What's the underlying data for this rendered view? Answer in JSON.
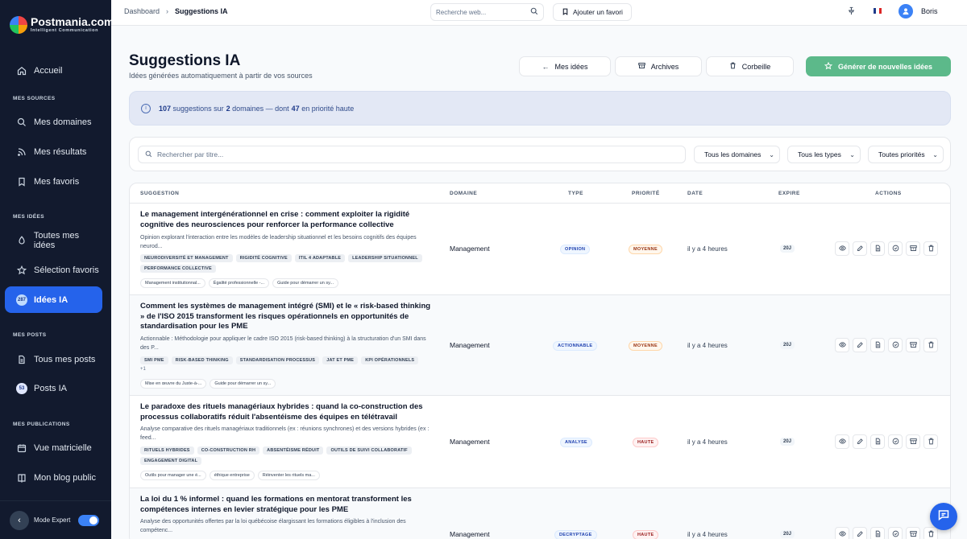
{
  "brand": {
    "name": "Postmania.com",
    "tagline": "Intelligent Communication"
  },
  "sidebar": {
    "home": "Accueil",
    "sections": {
      "sources": "MES SOURCES",
      "ideas": "MES IDÉES",
      "posts": "MES POSTS",
      "publications": "MES PUBLICATIONS"
    },
    "items": {
      "domains": "Mes domaines",
      "results": "Mes résultats",
      "favorites": "Mes favoris",
      "all_ideas": "Toutes mes idées",
      "fav_selection": "Sélection favoris",
      "ai_ideas": "Idées IA",
      "ai_ideas_badge": "287",
      "all_posts": "Tous mes posts",
      "ai_posts": "Posts IA",
      "ai_posts_badge": "53",
      "matrix": "Vue matricielle",
      "blog": "Mon blog public"
    },
    "mode_label": "Mode Expert"
  },
  "topbar": {
    "breadcrumb_home": "Dashboard",
    "breadcrumb_current": "Suggestions IA",
    "search_placeholder": "Recherche web...",
    "fav_label": "Ajouter un favori",
    "user_name": "Boris",
    "user_initial": "B"
  },
  "header": {
    "title": "Suggestions IA",
    "subtitle": "Idées générées automatiquement à partir de vos sources",
    "btn_ideas": "Mes idées",
    "btn_archives": "Archives",
    "btn_trash": "Corbeille",
    "btn_generate": "Générer de nouvelles idées"
  },
  "banner": {
    "count": "107",
    "t1": "suggestions sur",
    "domains": "2",
    "t2": "domaines — dont",
    "high": "47",
    "t3": "en priorité haute"
  },
  "filters": {
    "search_placeholder": "Rechercher par titre...",
    "domain": "Tous les domaines",
    "type": "Tous les types",
    "priority": "Toutes priorités"
  },
  "table": {
    "headers": {
      "suggestion": "SUGGESTION",
      "domain": "DOMAINE",
      "type": "TYPE",
      "priority": "PRIORITÉ",
      "date": "DATE",
      "expire": "EXPIRE",
      "actions": "ACTIONS"
    },
    "rows": [
      {
        "title": "Le management intergénérationnel en crise : comment exploiter la rigidité cognitive des neurosciences pour renforcer la performance collective",
        "desc": "Opinion explorant l'interaction entre les modèles de leadership situationnel et les besoins cognitifs des équipes neurod...",
        "tags": [
          "NEURODIVERSITÉ ET MANAGEMENT",
          "RIGIDITÉ COGNITIVE",
          "ITIL 4 ADAPTABLE",
          "LEADERSHIP SITUATIONNEL",
          "PERFORMANCE COLLECTIVE"
        ],
        "more": "",
        "links": [
          "Management institutionnal...",
          "Égalité professionnelle -...",
          "Guide pour démarrer un sy..."
        ],
        "domain": "Management",
        "type": "OPINION",
        "priority": "MOYENNE",
        "date": "il y a 4 heures",
        "expire": "20J"
      },
      {
        "title": "Comment les systèmes de management intégré (SMI) et le « risk-based thinking » de l'ISO 2015 transforment les risques opérationnels en opportunités de standardisation pour les PME",
        "desc": "Actionnable : Méthodologie pour appliquer le cadre ISO 2015 (risk-based thinking) à la structuration d'un SMI dans des P...",
        "tags": [
          "SMI PME",
          "RISK-BASED THINKING",
          "STANDARDISATION PROCESSUS",
          "JAT ET PME",
          "KPI OPÉRATIONNELS"
        ],
        "more": "+1",
        "links": [
          "Mise en œuvre du Juste-à-...",
          "Guide pour démarrer un sy..."
        ],
        "domain": "Management",
        "type": "ACTIONNABLE",
        "priority": "MOYENNE",
        "date": "il y a 4 heures",
        "expire": "20J"
      },
      {
        "title": "Le paradoxe des rituels managériaux hybrides : quand la co-construction des processus collaboratifs réduit l'absentéisme des équipes en télétravail",
        "desc": "Analyse comparative des rituels managériaux traditionnels (ex : réunions synchrones) et des versions hybrides (ex : feed...",
        "tags": [
          "RITUELS HYBRIDES",
          "CO-CONSTRUCTION RH",
          "ABSENTÉISME RÉDUIT",
          "OUTILS DE SUIVI COLLABORATIF",
          "ENGAGEMENT DIGITAL"
        ],
        "more": "",
        "links": [
          "Outils pour manager une é...",
          "éthique entreprise",
          "Réinventer les rituels ma..."
        ],
        "domain": "Management",
        "type": "ANALYSE",
        "priority": "HAUTE",
        "date": "il y a 4 heures",
        "expire": "20J"
      },
      {
        "title": "La loi du 1 % informel : quand les formations en mentorat transforment les compétences internes en levier stratégique pour les PME",
        "desc": "Analyse des opportunités offertes par la loi québécoise élargissant les formations éligibles à l'inclusion des compétenc...",
        "tags": [],
        "more": "",
        "links": [],
        "domain": "Management",
        "type": "DECRYPTAGE",
        "priority": "HAUTE",
        "date": "il y a 4 heures",
        "expire": "20J"
      }
    ]
  }
}
